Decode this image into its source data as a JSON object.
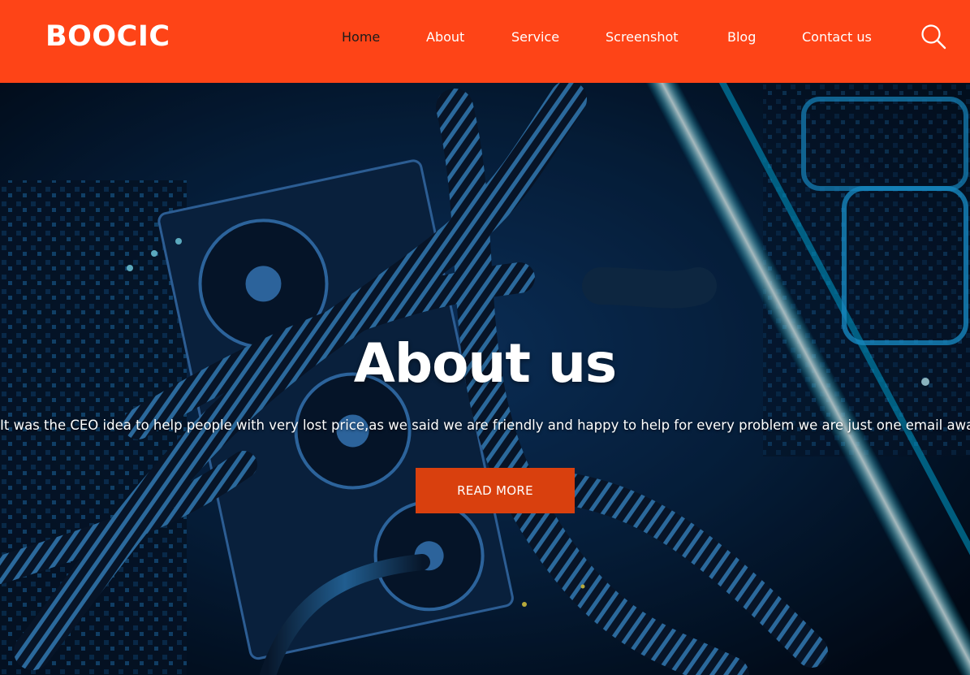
{
  "brand": {
    "logo_text": "BOOCIC",
    "header_color": "#fe4417",
    "accent_button_color": "#d9400e"
  },
  "nav": {
    "items": [
      {
        "label": "Home",
        "active": true
      },
      {
        "label": "About",
        "active": false
      },
      {
        "label": "Service",
        "active": false
      },
      {
        "label": "Screenshot",
        "active": false
      },
      {
        "label": "Blog",
        "active": false
      },
      {
        "label": "Contact us",
        "active": false
      }
    ],
    "search_icon": "search-icon"
  },
  "hero": {
    "title": "About us",
    "text": "It was the CEO idea to help people with very lost price,as we said we are friendly and happy to help for every problem we are just one email away",
    "button_label": "READ MORE",
    "background": "computer-hardware-photo"
  }
}
